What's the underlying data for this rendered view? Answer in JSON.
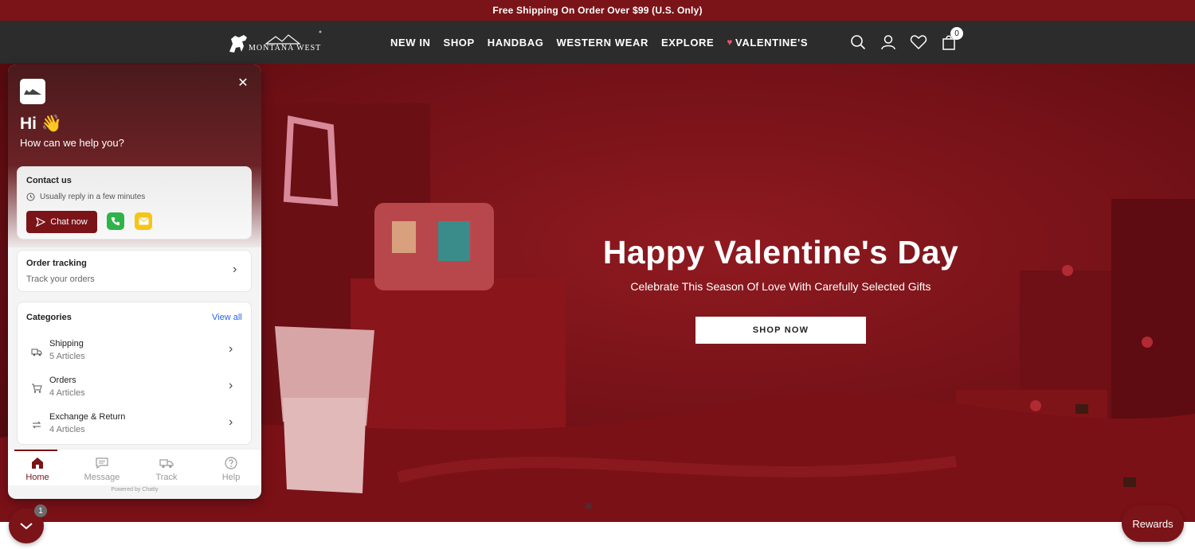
{
  "announcement": "Free Shipping On Order Over $99 (U.S. Only)",
  "header": {
    "logo_text": "MONTANA WEST",
    "nav": [
      "NEW IN",
      "SHOP",
      "HANDBAG",
      "WESTERN WEAR",
      "EXPLORE",
      "VALENTINE'S"
    ],
    "cart_count": "0",
    "icons": [
      "search-icon",
      "account-icon",
      "wishlist-icon",
      "cart-icon"
    ]
  },
  "hero": {
    "title": "Happy Valentine's Day",
    "subtitle": "Celebrate This Season Of Love With Carefully Selected Gifts",
    "cta": "SHOP NOW"
  },
  "chat_widget": {
    "greeting": "Hi 👋",
    "help_text": "How can we help you?",
    "contact": {
      "title": "Contact us",
      "reply_note": "Usually reply in a few minutes",
      "chat_button": "Chat now"
    },
    "order_tracking": {
      "title": "Order tracking",
      "subtitle": "Track your orders"
    },
    "categories": {
      "title": "Categories",
      "view_all": "View all",
      "items": [
        {
          "name": "Shipping",
          "count": "5 Articles"
        },
        {
          "name": "Orders",
          "count": "4 Articles"
        },
        {
          "name": "Exchange & Return",
          "count": "4 Articles"
        }
      ]
    },
    "tabs": [
      "Home",
      "Message",
      "Track",
      "Help"
    ],
    "powered_by": "Powered by Chatty"
  },
  "launcher_badge": "1",
  "rewards_label": "Rewards",
  "colors": {
    "brand": "#7a1418",
    "header_bg": "#2c2c2c",
    "link": "#2563eb"
  }
}
